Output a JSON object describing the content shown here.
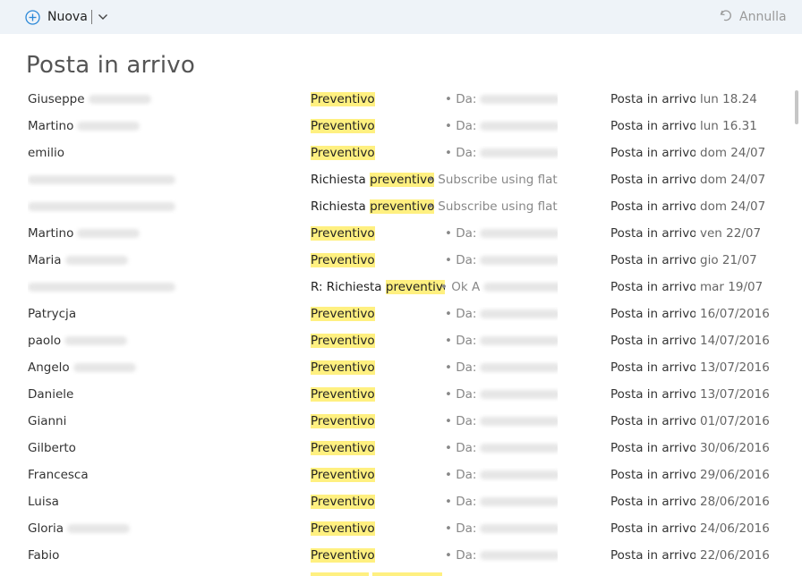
{
  "toolbar": {
    "new_label": "Nuova",
    "undo_label": "Annulla",
    "new_icon": "plus-circle-icon",
    "undo_icon": "undo-icon",
    "accent": "#2b88d8"
  },
  "folder_title": "Posta in arrivo",
  "messages": [
    {
      "sender": "Giuseppe",
      "blurred_sender": true,
      "subject_pre": "",
      "subject_hl": "Preventivo",
      "subject_post": "",
      "preview": "• Da:",
      "blurred_preview": true,
      "folder": "Posta in arrivo",
      "date": "lun 18.24"
    },
    {
      "sender": "Martino",
      "blurred_sender": true,
      "subject_pre": "",
      "subject_hl": "Preventivo",
      "subject_post": "",
      "preview": "• Da:",
      "blurred_preview": true,
      "folder": "Posta in arrivo",
      "date": "lun 16.31"
    },
    {
      "sender": "emilio",
      "blurred_sender": false,
      "subject_pre": "",
      "subject_hl": "Preventivo",
      "subject_post": "",
      "preview": "• Da:",
      "blurred_preview": true,
      "folder": "Posta in arrivo",
      "date": "dom 24/07"
    },
    {
      "sender": "",
      "blurred_sender": true,
      "subject_pre": "Richiesta ",
      "subject_hl": "preventivo",
      "subject_post": "",
      "preview": "• Subscribe using flatpac",
      "blurred_preview": false,
      "folder": "Posta in arrivo",
      "date": "dom 24/07"
    },
    {
      "sender": "",
      "blurred_sender": true,
      "subject_pre": "Richiesta ",
      "subject_hl": "preventivo",
      "subject_post": "",
      "preview": "• Subscribe using flatpac",
      "blurred_preview": false,
      "folder": "Posta in arrivo",
      "date": "dom 24/07"
    },
    {
      "sender": "Martino",
      "blurred_sender": true,
      "subject_pre": "",
      "subject_hl": "Preventivo",
      "subject_post": "",
      "preview": "• Da:",
      "blurred_preview": true,
      "folder": "Posta in arrivo",
      "date": "ven 22/07"
    },
    {
      "sender": "Maria",
      "blurred_sender": true,
      "subject_pre": "",
      "subject_hl": "Preventivo",
      "subject_post": "",
      "preview": "• Da:",
      "blurred_preview": true,
      "folder": "Posta in arrivo",
      "date": "gio 21/07"
    },
    {
      "sender": "",
      "blurred_sender": true,
      "subject_pre": "R: Richiesta ",
      "subject_hl": "preventivo",
      "subject_post": "",
      "preview": "• Ok A",
      "blurred_preview": true,
      "folder": "Posta in arrivo",
      "date": "mar 19/07"
    },
    {
      "sender": "Patrycja",
      "blurred_sender": false,
      "subject_pre": "",
      "subject_hl": "Preventivo",
      "subject_post": "",
      "preview": "• Da:",
      "blurred_preview": true,
      "folder": "Posta in arrivo",
      "date": "16/07/2016"
    },
    {
      "sender": "paolo",
      "blurred_sender": true,
      "subject_pre": "",
      "subject_hl": "Preventivo",
      "subject_post": "",
      "preview": "• Da:",
      "blurred_preview": true,
      "folder": "Posta in arrivo",
      "date": "14/07/2016"
    },
    {
      "sender": "Angelo",
      "blurred_sender": true,
      "subject_pre": "",
      "subject_hl": "Preventivo",
      "subject_post": "",
      "preview": "• Da:",
      "blurred_preview": true,
      "folder": "Posta in arrivo",
      "date": "13/07/2016"
    },
    {
      "sender": "Daniele",
      "blurred_sender": false,
      "subject_pre": "",
      "subject_hl": "Preventivo",
      "subject_post": "",
      "preview": "• Da:",
      "blurred_preview": true,
      "folder": "Posta in arrivo",
      "date": "13/07/2016"
    },
    {
      "sender": "Gianni",
      "blurred_sender": false,
      "subject_pre": "",
      "subject_hl": "Preventivo",
      "subject_post": "",
      "preview": "• Da:",
      "blurred_preview": true,
      "folder": "Posta in arrivo",
      "date": "01/07/2016"
    },
    {
      "sender": "Gilberto",
      "blurred_sender": false,
      "subject_pre": "",
      "subject_hl": "Preventivo",
      "subject_post": "",
      "preview": "• Da:",
      "blurred_preview": true,
      "folder": "Posta in arrivo",
      "date": "30/06/2016"
    },
    {
      "sender": "Francesca",
      "blurred_sender": false,
      "subject_pre": "",
      "subject_hl": "Preventivo",
      "subject_post": "",
      "preview": "• Da:",
      "blurred_preview": true,
      "folder": "Posta in arrivo",
      "date": "29/06/2016"
    },
    {
      "sender": "Luisa",
      "blurred_sender": false,
      "subject_pre": "",
      "subject_hl": "Preventivo",
      "subject_post": "",
      "preview": "• Da:",
      "blurred_preview": true,
      "folder": "Posta in arrivo",
      "date": "28/06/2016"
    },
    {
      "sender": "Gloria",
      "blurred_sender": true,
      "subject_pre": "",
      "subject_hl": "Preventivo",
      "subject_post": "",
      "preview": "• Da:",
      "blurred_preview": true,
      "folder": "Posta in arrivo",
      "date": "24/06/2016"
    },
    {
      "sender": "Fabio",
      "blurred_sender": false,
      "subject_pre": "",
      "subject_hl": "Preventivo",
      "subject_post": "",
      "preview": "• Da:",
      "blurred_preview": true,
      "folder": "Posta in arrivo",
      "date": "22/06/2016"
    }
  ],
  "colors": {
    "toolbar_bg": "#eef3f8",
    "highlight": "#fff080",
    "muted_text": "#888888"
  }
}
